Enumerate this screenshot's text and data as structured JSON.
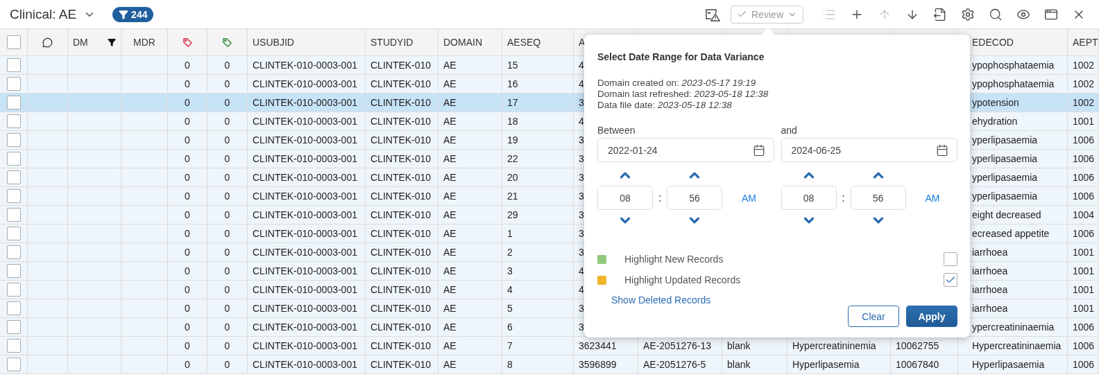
{
  "toolbar": {
    "title": "Clinical: AE",
    "filter_count": "244",
    "review": {
      "label": "Review",
      "disabled": true
    },
    "actions": [
      {
        "kind": "list",
        "disabled": true
      },
      {
        "kind": "add",
        "disabled": false
      },
      {
        "kind": "up",
        "disabled": true
      },
      {
        "kind": "down",
        "disabled": false
      },
      {
        "kind": "export",
        "disabled": false
      },
      {
        "kind": "settings",
        "disabled": false
      },
      {
        "kind": "search",
        "disabled": false
      },
      {
        "kind": "view",
        "disabled": false
      },
      {
        "kind": "layout",
        "disabled": false
      },
      {
        "kind": "close",
        "disabled": false
      }
    ]
  },
  "table": {
    "columns": [
      {
        "kind": "checkbox",
        "checked": false
      },
      {
        "kind": "comment"
      },
      {
        "kind": "text",
        "label": "DM",
        "filtered": true
      },
      {
        "kind": "text",
        "label": "MDR",
        "filtered": false
      },
      {
        "kind": "tag",
        "color": "#d9455f"
      },
      {
        "kind": "tag",
        "color": "#4c9a52"
      },
      {
        "kind": "text",
        "label": "USUBJID",
        "filtered": false
      },
      {
        "kind": "text",
        "label": "STUDYID",
        "filtered": false
      },
      {
        "kind": "text",
        "label": "DOMAIN",
        "filtered": false
      },
      {
        "kind": "text",
        "label": "AESEQ",
        "filtered": false
      },
      {
        "kind": "text",
        "label": "A",
        "filtered": false
      },
      {
        "kind": "blank"
      },
      {
        "kind": "blank"
      },
      {
        "kind": "blank"
      },
      {
        "kind": "blank"
      },
      {
        "kind": "text",
        "label": "EDECOD",
        "filtered": false
      },
      {
        "kind": "text",
        "label": "AEPT",
        "filtered": false
      }
    ],
    "rows": [
      {
        "selected": false,
        "checked": false,
        "cells": [
          "",
          "",
          "",
          "",
          "0",
          "0",
          "CLINTEK-010-0003-001",
          "CLINTEK-010",
          "AE",
          "15",
          "4",
          null,
          null,
          null,
          null,
          "ypophosphataemia",
          "1002"
        ]
      },
      {
        "selected": false,
        "checked": false,
        "cells": [
          "",
          "",
          "",
          "",
          "0",
          "0",
          "CLINTEK-010-0003-001",
          "CLINTEK-010",
          "AE",
          "16",
          "4",
          null,
          null,
          null,
          null,
          "ypophosphataemia",
          "1002"
        ]
      },
      {
        "selected": true,
        "checked": false,
        "cells": [
          "",
          "",
          "",
          "",
          "0",
          "0",
          "CLINTEK-010-0003-001",
          "CLINTEK-010",
          "AE",
          "17",
          "3",
          null,
          null,
          null,
          null,
          "ypotension",
          "1002"
        ]
      },
      {
        "selected": false,
        "checked": false,
        "cells": [
          "",
          "",
          "",
          "",
          "0",
          "0",
          "CLINTEK-010-0003-001",
          "CLINTEK-010",
          "AE",
          "18",
          "4",
          null,
          null,
          null,
          null,
          "ehydration",
          "1001"
        ]
      },
      {
        "selected": false,
        "checked": false,
        "cells": [
          "",
          "",
          "",
          "",
          "0",
          "0",
          "CLINTEK-010-0003-001",
          "CLINTEK-010",
          "AE",
          "19",
          "3",
          null,
          null,
          null,
          null,
          "yperlipasaemia",
          "1006"
        ]
      },
      {
        "selected": false,
        "checked": false,
        "cells": [
          "",
          "",
          "",
          "",
          "0",
          "0",
          "CLINTEK-010-0003-001",
          "CLINTEK-010",
          "AE",
          "22",
          "3",
          null,
          null,
          null,
          null,
          "yperlipasaemia",
          "1006"
        ]
      },
      {
        "selected": false,
        "checked": false,
        "cells": [
          "",
          "",
          "",
          "",
          "0",
          "0",
          "CLINTEK-010-0003-001",
          "CLINTEK-010",
          "AE",
          "20",
          "3",
          null,
          null,
          null,
          null,
          "yperlipasaemia",
          "1006"
        ]
      },
      {
        "selected": false,
        "checked": false,
        "cells": [
          "",
          "",
          "",
          "",
          "0",
          "0",
          "CLINTEK-010-0003-001",
          "CLINTEK-010",
          "AE",
          "21",
          "3",
          null,
          null,
          null,
          null,
          "yperlipasaemia",
          "1006"
        ]
      },
      {
        "selected": false,
        "checked": false,
        "cells": [
          "",
          "",
          "",
          "",
          "0",
          "0",
          "CLINTEK-010-0003-001",
          "CLINTEK-010",
          "AE",
          "29",
          "3",
          null,
          null,
          null,
          null,
          "eight decreased",
          "1004"
        ]
      },
      {
        "selected": false,
        "checked": false,
        "cells": [
          "",
          "",
          "",
          "",
          "0",
          "0",
          "CLINTEK-010-0003-001",
          "CLINTEK-010",
          "AE",
          "1",
          "3",
          null,
          null,
          null,
          null,
          "ecreased appetite",
          "1006"
        ]
      },
      {
        "selected": false,
        "checked": false,
        "cells": [
          "",
          "",
          "",
          "",
          "0",
          "0",
          "CLINTEK-010-0003-001",
          "CLINTEK-010",
          "AE",
          "2",
          "3",
          null,
          null,
          null,
          null,
          "iarrhoea",
          "1001"
        ]
      },
      {
        "selected": false,
        "checked": false,
        "cells": [
          "",
          "",
          "",
          "",
          "0",
          "0",
          "CLINTEK-010-0003-001",
          "CLINTEK-010",
          "AE",
          "3",
          "4",
          null,
          null,
          null,
          null,
          "iarrhoea",
          "1001"
        ]
      },
      {
        "selected": false,
        "checked": false,
        "cells": [
          "",
          "",
          "",
          "",
          "0",
          "0",
          "CLINTEK-010-0003-001",
          "CLINTEK-010",
          "AE",
          "4",
          "4",
          null,
          null,
          null,
          null,
          "iarrhoea",
          "1001"
        ]
      },
      {
        "selected": false,
        "checked": false,
        "cells": [
          "",
          "",
          "",
          "",
          "0",
          "0",
          "CLINTEK-010-0003-001",
          "CLINTEK-010",
          "AE",
          "5",
          "3",
          null,
          null,
          null,
          null,
          "iarrhoea",
          "1001"
        ]
      },
      {
        "selected": false,
        "checked": false,
        "cells": [
          "",
          "",
          "",
          "",
          "0",
          "0",
          "CLINTEK-010-0003-001",
          "CLINTEK-010",
          "AE",
          "6",
          "3",
          null,
          null,
          null,
          null,
          "ypercreatininaemia",
          "1006"
        ]
      },
      {
        "selected": false,
        "checked": false,
        "cells": [
          "",
          "",
          "",
          "",
          "0",
          "0",
          "CLINTEK-010-0003-001",
          "CLINTEK-010",
          "AE",
          "7",
          "3623441",
          "AE-2051276-13",
          "blank",
          "Hypercreatininemia",
          "10062755",
          "Hypercreatininaemia",
          "1006"
        ]
      },
      {
        "selected": false,
        "checked": false,
        "cells": [
          "",
          "",
          "",
          "",
          "0",
          "0",
          "CLINTEK-010-0003-001",
          "CLINTEK-010",
          "AE",
          "8",
          "3596899",
          "AE-2051276-5",
          "blank",
          "Hyperlipasemia",
          "10067840",
          "Hyperlipasaemia",
          "1006"
        ]
      }
    ]
  },
  "popup": {
    "title": "Select Date Range for Data Variance",
    "info": [
      {
        "label": "Domain created on:",
        "value": "2023-05-17 19:19"
      },
      {
        "label": "Domain last refreshed:",
        "value": "2023-05-18 12:38"
      },
      {
        "label": "Data file date:",
        "value": "2023-05-18 12:38"
      }
    ],
    "ranges": [
      {
        "label": "Between",
        "date": "2022-01-24",
        "hour": "08",
        "minute": "56",
        "separator": ":",
        "period": "AM"
      },
      {
        "label": "and",
        "date": "2024-06-25",
        "hour": "08",
        "minute": "56",
        "separator": ":",
        "period": "AM"
      }
    ],
    "highlights": [
      {
        "label": "Highlight New Records",
        "color": "#8ec97e",
        "checked": false
      },
      {
        "label": "Highlight Updated Records",
        "color": "#f0b429",
        "checked": true
      }
    ],
    "link": "Show Deleted Records",
    "buttons": [
      {
        "label": "Clear",
        "kind": "secondary"
      },
      {
        "label": "Apply",
        "kind": "primary"
      }
    ]
  }
}
